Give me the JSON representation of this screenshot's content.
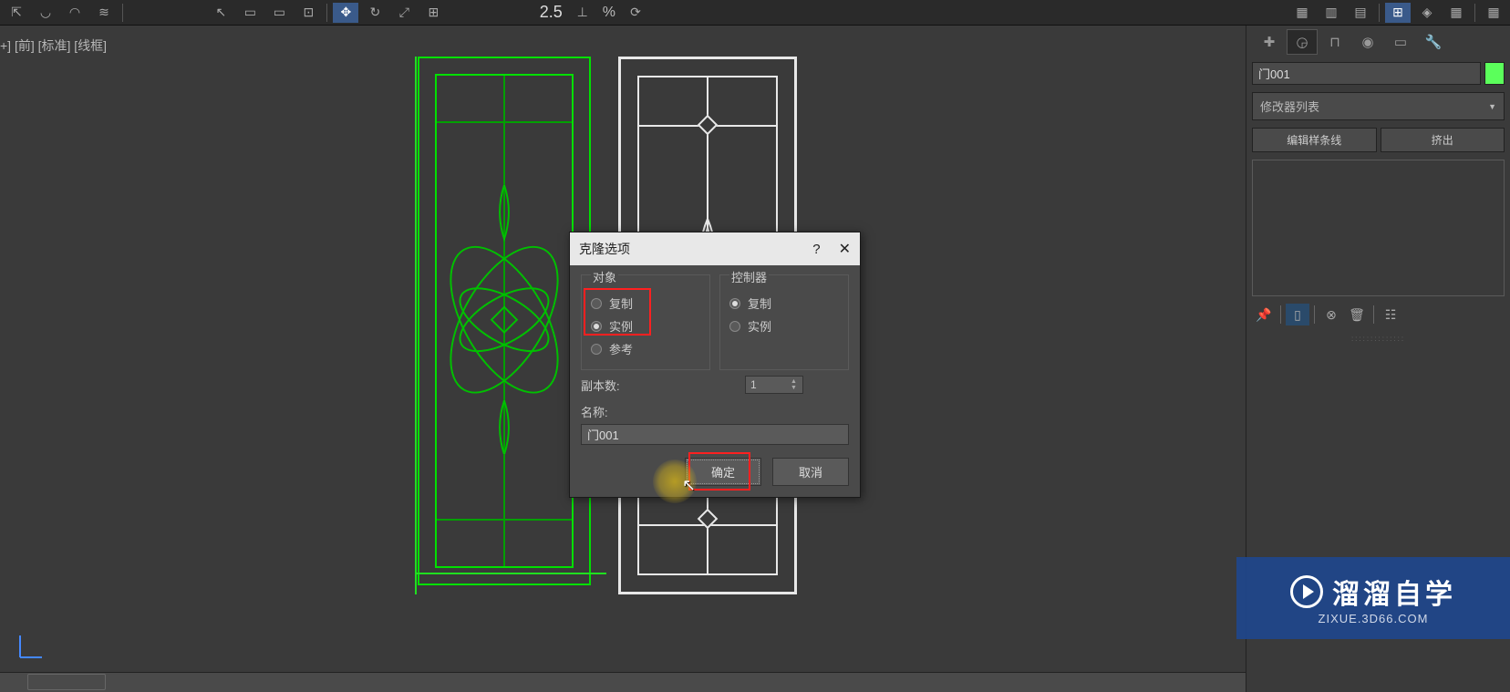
{
  "toolbar": {
    "value_25": "2.5",
    "percent": "%"
  },
  "viewport": {
    "label": "+] [前] [标准] [线框]"
  },
  "panel": {
    "object_name": "门001",
    "modifier_list": "修改器列表",
    "btn_edit_spline": "编辑样条线",
    "btn_extrude": "挤出"
  },
  "dialog": {
    "title": "克隆选项",
    "group_object": "对象",
    "group_controller": "控制器",
    "opt_copy": "复制",
    "opt_instance": "实例",
    "opt_reference": "参考",
    "copies_label": "副本数:",
    "copies_value": "1",
    "name_label": "名称:",
    "name_value": "门001",
    "btn_ok": "确定",
    "btn_cancel": "取消"
  },
  "watermark": {
    "main": "溜溜自学",
    "sub": "ZIXUE.3D66.COM"
  },
  "icons": {
    "help": "?",
    "close": "✕",
    "dropdown": "▼"
  }
}
